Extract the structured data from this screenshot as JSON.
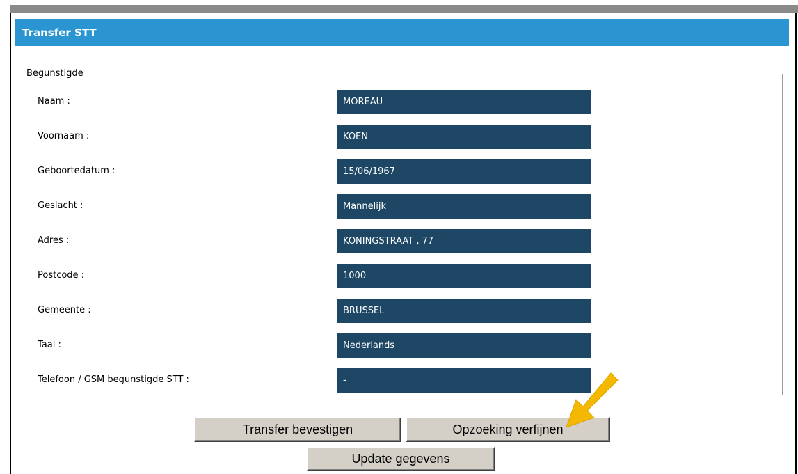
{
  "panel": {
    "title": "Transfer STT"
  },
  "fieldset": {
    "legend": "Begunstigde",
    "rows": [
      {
        "label": "Naam :",
        "value": "MOREAU"
      },
      {
        "label": "Voornaam :",
        "value": "KOEN"
      },
      {
        "label": "Geboortedatum :",
        "value": "15/06/1967"
      },
      {
        "label": "Geslacht :",
        "value": "Mannelijk"
      },
      {
        "label": "Adres :",
        "value": "KONINGSTRAAT , 77"
      },
      {
        "label": "Postcode :",
        "value": "1000"
      },
      {
        "label": "Gemeente :",
        "value": "BRUSSEL"
      },
      {
        "label": "Taal :",
        "value": "Nederlands"
      },
      {
        "label": "Telefoon / GSM begunstigde STT :",
        "value": "-"
      }
    ]
  },
  "buttons": {
    "confirm": "Transfer bevestigen",
    "refine": "Opzoeking verfijnen",
    "update": "Update gegevens"
  },
  "colors": {
    "header": "#2b95d1",
    "field_background": "#1e4766",
    "arrow": "#f5b800"
  },
  "annotation": {
    "icon": "pointer-arrow-icon"
  }
}
